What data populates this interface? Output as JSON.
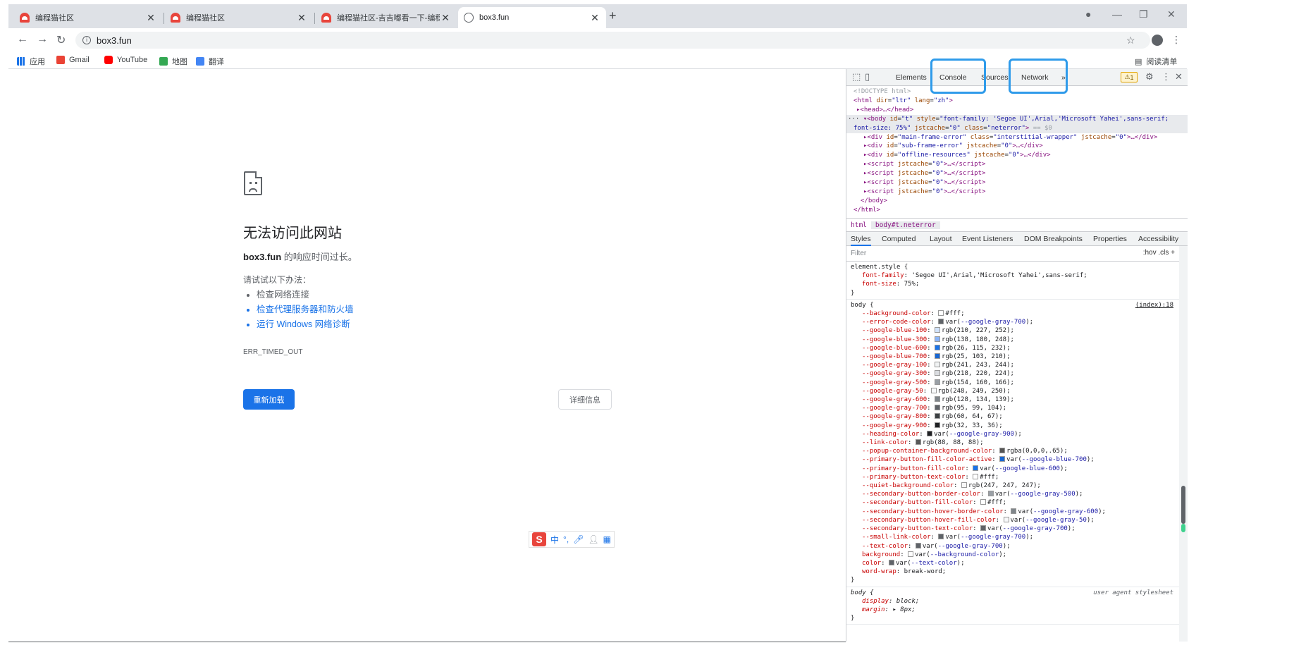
{
  "tabs": [
    {
      "title": "编程猫社区",
      "favicon": "cat-logo-icon",
      "active": false
    },
    {
      "title": "编程猫社区",
      "favicon": "cat-logo-icon",
      "active": false
    },
    {
      "title": "编程猫社区-吉吉嘟看一下-编程猫",
      "favicon": "cat-logo-icon",
      "active": false
    },
    {
      "title": "box3.fun",
      "favicon": "globe-icon",
      "active": true
    }
  ],
  "toolbar": {
    "url": "box3.fun"
  },
  "bookmarks": [
    "应用",
    "Gmail",
    "YouTube",
    "地图",
    "翻译"
  ],
  "reading_list": "阅读清单",
  "error_page": {
    "heading": "无法访问此网站",
    "host": "box3.fun",
    "desc_suffix": " 的响应时间过长。",
    "try_label": "请试试以下办法：",
    "suggestions": [
      "检查网络连接",
      "检查代理服务器和防火墙",
      "运行 Windows 网络诊断"
    ],
    "error_code": "ERR_TIMED_OUT",
    "reload_label": "重新加载",
    "details_label": "详细信息"
  },
  "ime": {
    "label": "中"
  },
  "devtools": {
    "tabs": [
      "Elements",
      "Console",
      "Sources",
      "Network"
    ],
    "warning_count": "1",
    "breadcrumbs": [
      "html",
      "body#t.neterror"
    ],
    "panel_tabs": [
      "Styles",
      "Computed",
      "Layout",
      "Event Listeners",
      "DOM Breakpoints",
      "Properties",
      "Accessibility"
    ],
    "filter_placeholder": "Filter",
    "filter_tools": ":hov  .cls  +",
    "accent": "#2f9bea"
  }
}
